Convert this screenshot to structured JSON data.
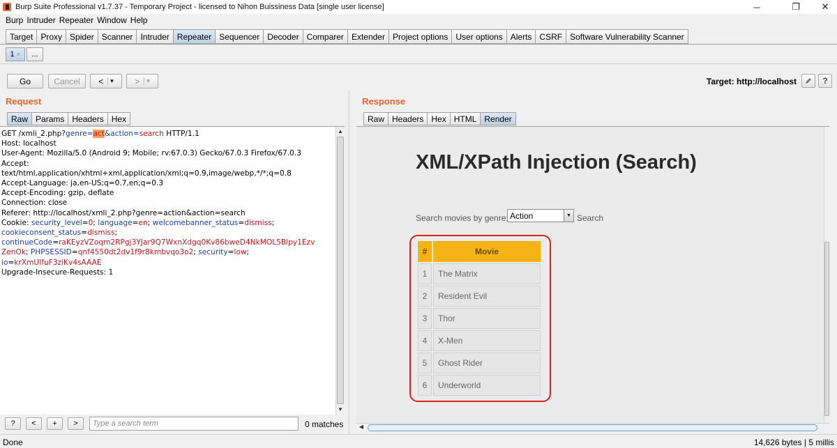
{
  "window": {
    "title": "Burp Suite Professional v1.7.37 - Temporary Project - licensed to Nihon Buissiness Data [single user license]",
    "controls": [
      "─",
      "❐",
      "✕"
    ]
  },
  "menu": [
    "Burp",
    "Intruder",
    "Repeater",
    "Window",
    "Help"
  ],
  "main_tabs": [
    "Target",
    "Proxy",
    "Spider",
    "Scanner",
    "Intruder",
    "Repeater",
    "Sequencer",
    "Decoder",
    "Comparer",
    "Extender",
    "Project options",
    "User options",
    "Alerts",
    "CSRF",
    "Software Vulnerability Scanner"
  ],
  "main_tab_active": "Repeater",
  "repeater_tabs": {
    "first": "1",
    "close": "×",
    "more": "..."
  },
  "toolbar": {
    "go": "Go",
    "cancel": "Cancel",
    "back": "<",
    "back_dd": "▾",
    "forward": ">",
    "forward_dd": "▾"
  },
  "target": {
    "label": "Target: http://localhost",
    "edit_icon": "pencil-icon",
    "help_icon": "?"
  },
  "request": {
    "title": "Request",
    "tabs": [
      "Raw",
      "Params",
      "Headers",
      "Hex"
    ],
    "lines": [
      "GET /xmli_2.php?genre=act&action=search HTTP/1.1",
      "Host: localhost",
      "User-Agent: Mozilla/5.0 (Android 9; Mobile; rv:67.0.3) Gecko/67.0.3 Firefox/67.0.3",
      "Accept:",
      "text/html,application/xhtml+xml,application/xml;q=0.9,image/webp,*/*;q=0.8",
      "Accept-Language: ja,en-US;q=0.7,en;q=0.3",
      "Accept-Encoding: gzip, deflate",
      "Connection: close",
      "Referer: http://localhost/xmli_2.php?genre=action&action=search",
      "Cookie: security_level=0; language=en; welcomebanner_status=dismiss;",
      "cookieconsent_status=dismiss;",
      "continueCode=raKEyzVZoqm2RPgj3YJar9Q7WxnXdgq0Kv86bweD4NkMOL5Blpy1Ezv",
      "ZenOk; PHPSESSID=qnf4550dt2dv1f9r8kmbvqo3o2; security=low;",
      "io=krXmUIfuF3ziKv4sAAAE",
      "Upgrade-Insecure-Requests: 1"
    ],
    "parts": {
      "l1a": "GET /xmli_2.php?",
      "l1k1": "genre",
      "l1eq1": "=",
      "l1v1": "act",
      "l1amp": "&",
      "l1k2": "action",
      "l1eq2": "=",
      "l1v2": "search",
      "l1b": " HTTP/1.1",
      "cookie_prefix": "Cookie: ",
      "c1k": "security_level",
      "c1v": "0",
      "c2k": "language",
      "c2v": "en",
      "c3k": "welcomebanner_status",
      "c3v": "dismiss",
      "c4k": "cookieconsent_status",
      "c4v": "dismiss",
      "c5k": "continueCode",
      "c5v1": "raKEyzVZoqm2RPgj3YJar9Q7WxnXdgq0Kv86bweD4NkMOL5Blpy1Ezv",
      "c5v2": "ZenOk",
      "c6k": "PHPSESSID",
      "c6v": "qnf4550dt2dv1f9r8kmbvqo3o2",
      "c7k": "security",
      "c7v": "low",
      "c8k": "io",
      "c8v": "krXmUIfuF3ziKv4sAAAE"
    }
  },
  "response": {
    "title": "Response",
    "tabs": [
      "Raw",
      "Headers",
      "Hex",
      "HTML",
      "Render"
    ],
    "active_tab": "Render",
    "page": {
      "heading": "XML/XPath Injection (Search)",
      "search_label": "Search movies by genre:",
      "selected_genre": "Action",
      "search_button": "Search",
      "table_headers": [
        "#",
        "Movie"
      ],
      "movies": [
        {
          "num": "1",
          "name": "The Matrix"
        },
        {
          "num": "2",
          "name": "Resident Evil"
        },
        {
          "num": "3",
          "name": "Thor"
        },
        {
          "num": "4",
          "name": "X-Men"
        },
        {
          "num": "5",
          "name": "Ghost Rider"
        },
        {
          "num": "6",
          "name": "Underworld"
        }
      ],
      "highlight_color": "#d9201b"
    }
  },
  "search": {
    "help": "?",
    "prev": "<",
    "add": "+",
    "next": ">",
    "placeholder": "Type a search term",
    "matches": "0 matches"
  },
  "status": {
    "left": "Done",
    "right": "14,626 bytes | 5 millis"
  },
  "colors": {
    "accent": "#e8662b",
    "param_key": "#1a3fb0",
    "param_value": "#c4181e",
    "highlight": "#f5a05a",
    "table_header": "#f5b315"
  }
}
